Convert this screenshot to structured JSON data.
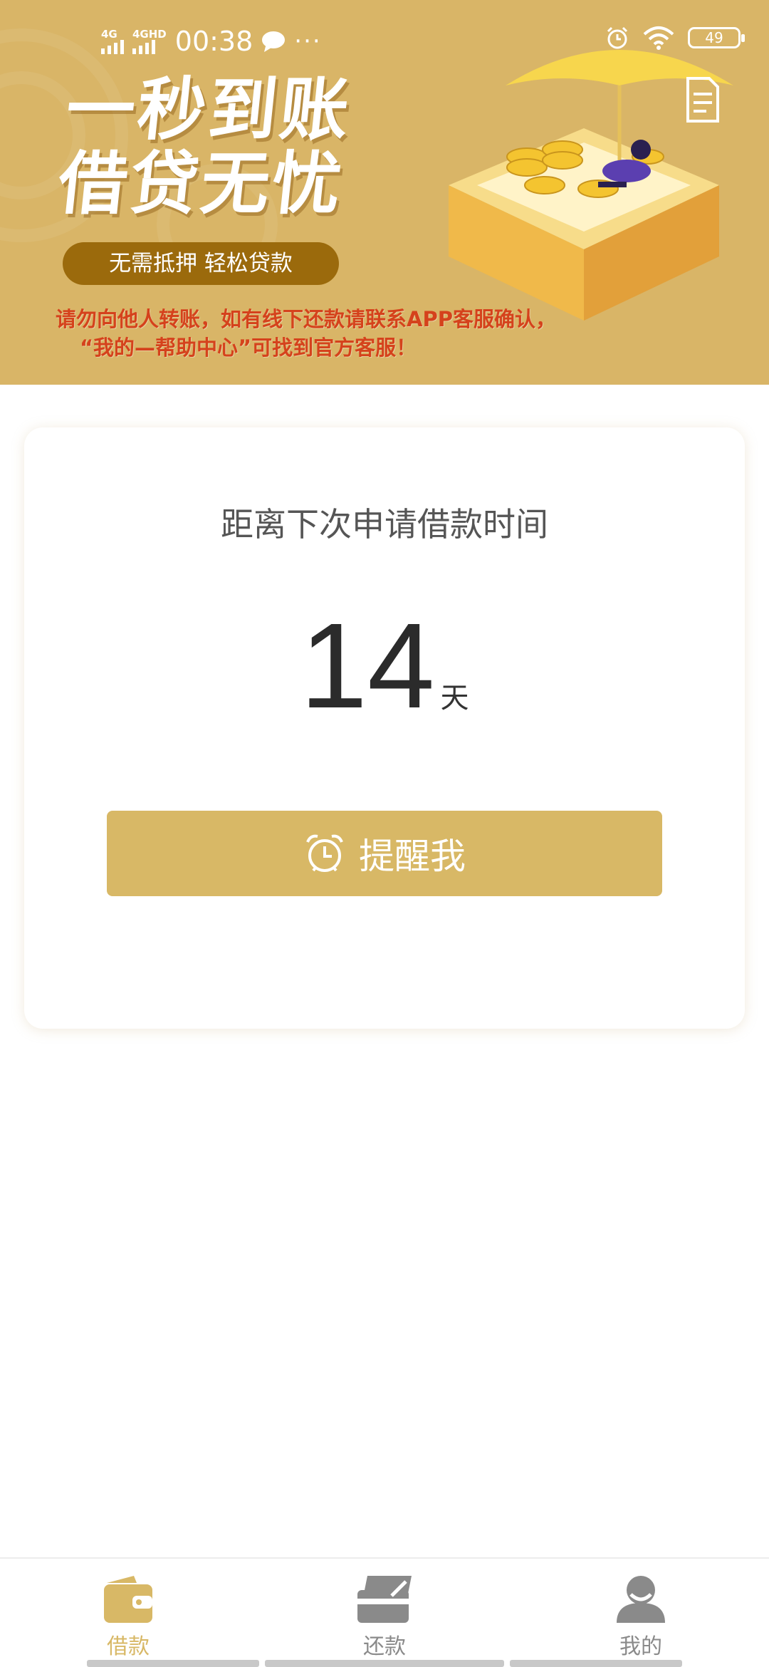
{
  "status_bar": {
    "network1": "4G",
    "network2": "4GHD",
    "time": "00:38",
    "battery": "49"
  },
  "banner": {
    "headline_line1": "一秒到账",
    "headline_line2": "借贷无忧",
    "pill_text": "无需抵押  轻松贷款",
    "warning_line1": "请勿向他人转账，如有线下还款请联系APP客服确认，",
    "warning_line2": "“我的—帮助中心”可找到官方客服！"
  },
  "card": {
    "title": "距离下次申请借款时间",
    "count": "14",
    "unit": "天",
    "remind_label": "提醒我"
  },
  "tabbar": {
    "tabs": [
      {
        "label": "借款",
        "active": true
      },
      {
        "label": "还款",
        "active": false
      },
      {
        "label": "我的",
        "active": false
      }
    ]
  },
  "colors": {
    "banner": "#d9b567",
    "accent": "#d8b866",
    "pill": "#9b6a0c",
    "warning": "#d5421c"
  }
}
